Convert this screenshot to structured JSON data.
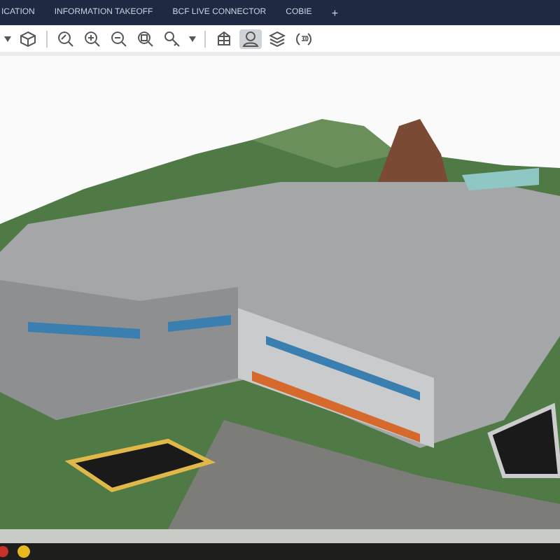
{
  "tabs": [
    {
      "label": "ICATION"
    },
    {
      "label": "INFORMATION TAKEOFF"
    },
    {
      "label": "BCF LIVE CONNECTOR"
    },
    {
      "label": "COBIE"
    }
  ],
  "add_tab": "+",
  "toolbar": [
    {
      "kind": "caret",
      "selected": false
    },
    {
      "kind": "cube",
      "selected": false
    },
    {
      "kind": "fit",
      "selected": false
    },
    {
      "kind": "zoom-in",
      "selected": false
    },
    {
      "kind": "zoom-out",
      "selected": false
    },
    {
      "kind": "zoom-window",
      "selected": false
    },
    {
      "kind": "key",
      "selected": false
    },
    {
      "kind": "caret",
      "selected": false
    },
    {
      "kind": "section",
      "selected": false
    },
    {
      "kind": "person",
      "selected": true
    },
    {
      "kind": "layers",
      "selected": false
    },
    {
      "kind": "rotate3d",
      "selected": false
    }
  ]
}
